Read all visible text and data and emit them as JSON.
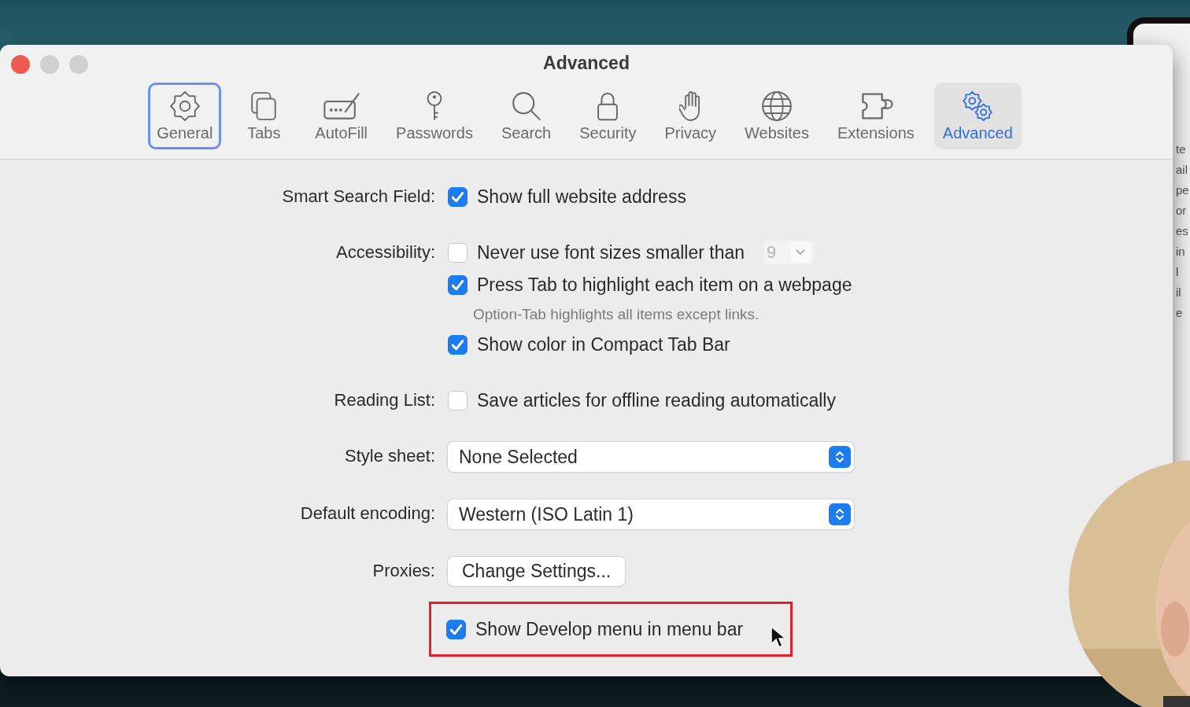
{
  "window": {
    "title": "Advanced",
    "toolbar": [
      {
        "label": "General",
        "selected": false,
        "focused": true
      },
      {
        "label": "Tabs",
        "selected": false,
        "focused": false
      },
      {
        "label": "AutoFill",
        "selected": false,
        "focused": false
      },
      {
        "label": "Passwords",
        "selected": false,
        "focused": false
      },
      {
        "label": "Search",
        "selected": false,
        "focused": false
      },
      {
        "label": "Security",
        "selected": false,
        "focused": false
      },
      {
        "label": "Privacy",
        "selected": false,
        "focused": false
      },
      {
        "label": "Websites",
        "selected": false,
        "focused": false
      },
      {
        "label": "Extensions",
        "selected": false,
        "focused": false
      },
      {
        "label": "Advanced",
        "selected": true,
        "focused": false
      }
    ],
    "sections": [
      {
        "label": "Smart Search Field:",
        "highlighted": false,
        "items": [
          {
            "kind": "checkbox",
            "text": "Show full website address",
            "checked": true
          }
        ]
      },
      {
        "label": "Accessibility:",
        "highlighted": false,
        "items": [
          {
            "kind": "checkbox",
            "text": "Never use font sizes smaller than",
            "checked": false,
            "font_size": {
              "value": "9",
              "disabled": true
            }
          },
          {
            "kind": "checkbox",
            "text": "Press Tab to highlight each item on a webpage",
            "checked": true
          },
          {
            "kind": "hint",
            "text": "Option-Tab highlights all items except links."
          },
          {
            "kind": "checkbox",
            "text": "Show color in Compact Tab Bar",
            "checked": true
          }
        ]
      },
      {
        "label": "Reading List:",
        "highlighted": false,
        "items": [
          {
            "kind": "checkbox",
            "text": "Save articles for offline reading automatically",
            "checked": false
          }
        ]
      },
      {
        "label": "Style sheet:",
        "highlighted": false,
        "items": [
          {
            "kind": "popup",
            "text": "None Selected"
          }
        ]
      },
      {
        "label": "Default encoding:",
        "highlighted": false,
        "items": [
          {
            "kind": "popup",
            "text": "Western (ISO Latin 1)"
          }
        ]
      },
      {
        "label": "Proxies:",
        "highlighted": false,
        "items": [
          {
            "kind": "button",
            "text": "Change Settings..."
          }
        ]
      },
      {
        "highlighted": true,
        "items": [
          {
            "kind": "checkbox",
            "text": "Show Develop menu in menu bar",
            "checked": true
          }
        ]
      }
    ]
  },
  "background_window": {
    "fragments": [
      "te",
      "ail",
      "pe",
      "or",
      "es",
      "in",
      "l",
      "il",
      "e"
    ]
  }
}
